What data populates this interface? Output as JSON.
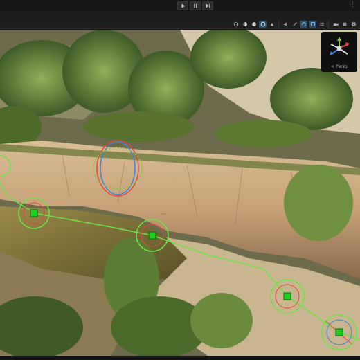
{
  "window": {
    "overflow_label": "⋮"
  },
  "play_controls": [
    {
      "name": "play-button",
      "icon": "play-icon"
    },
    {
      "name": "pause-button",
      "icon": "pause-icon"
    },
    {
      "name": "step-button",
      "icon": "step-icon"
    }
  ],
  "viewport_toolbar": {
    "icons": [
      "global-icon",
      "lit-icon",
      "sphere-icon",
      "sky-icon",
      "effects-icon",
      "audio-icon",
      "move-tool-icon",
      "rotate-tool-icon",
      "snap-icon",
      "grid-icon",
      "camera-icon",
      "gizmo-toggle-icon",
      "settings-icon"
    ],
    "accent": "#3a8fd1"
  },
  "scene_gizmo": {
    "projection_label": "< Persp",
    "axis_colors": {
      "x": "#e0493c",
      "y": "#8ec542",
      "z": "#3f84d8",
      "neutral": "#d9d9d9"
    }
  },
  "scene": {
    "path_color": "#6fe04a",
    "marker_color": "#1fd11f"
  }
}
